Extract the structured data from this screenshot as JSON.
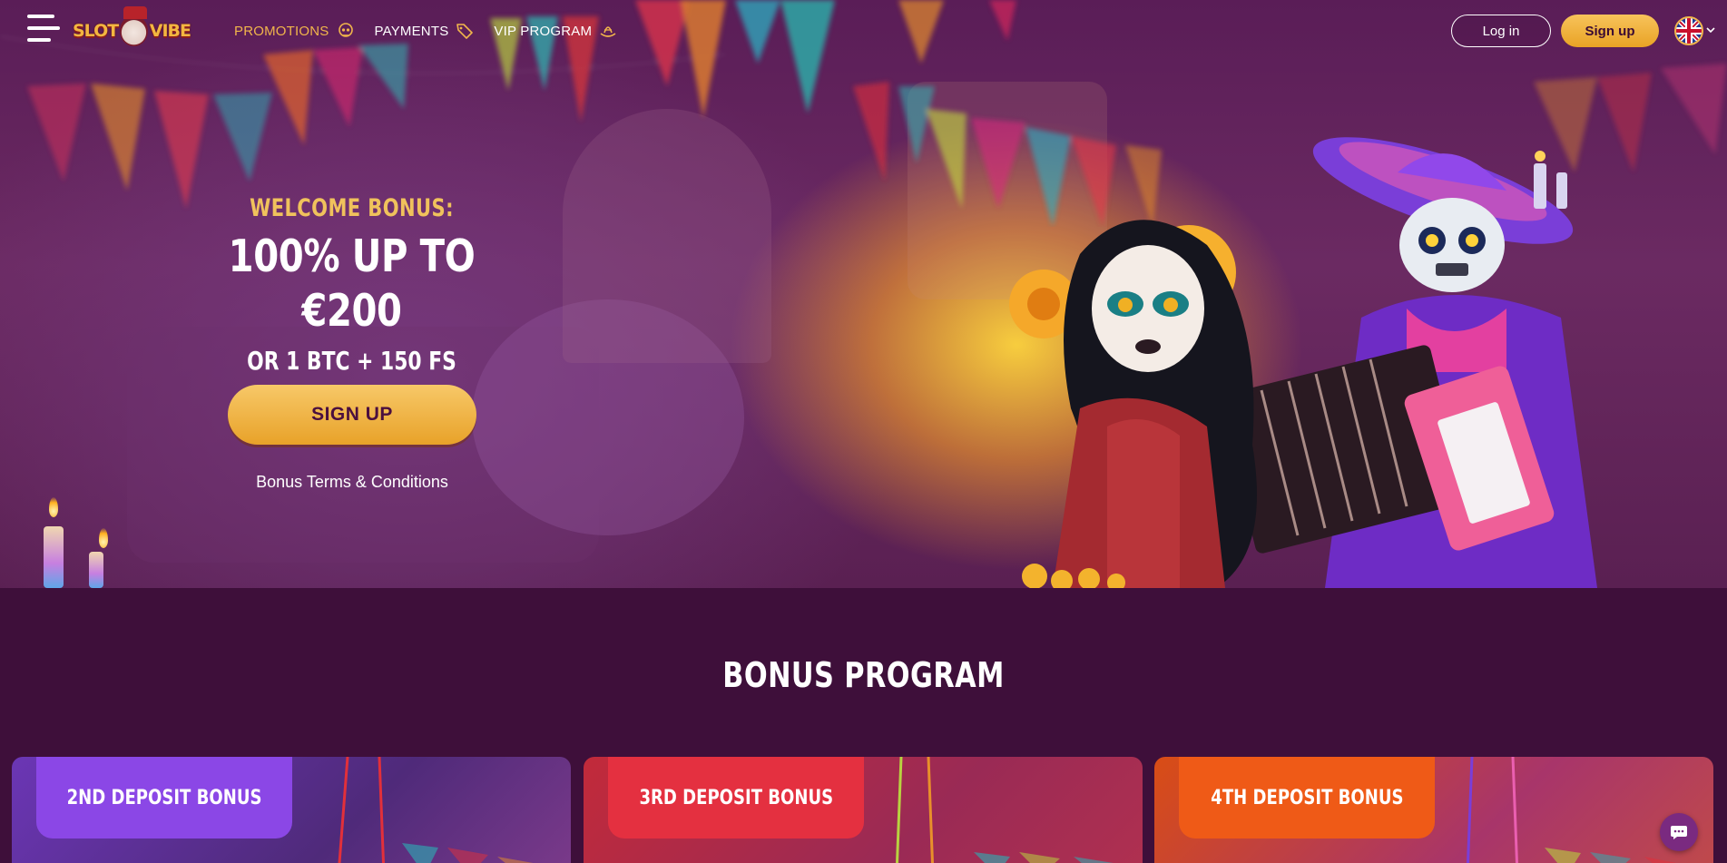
{
  "header": {
    "logo_alt": "Slot Vibe",
    "logo_text_left": "SLOT",
    "logo_text_right": "VIBE",
    "nav": [
      {
        "label": "PROMOTIONS",
        "icon": "sugar-skull-icon",
        "active": true
      },
      {
        "label": "PAYMENTS",
        "icon": "tag-icon",
        "active": false
      },
      {
        "label": "VIP PROGRAM",
        "icon": "sombrero-icon",
        "active": false
      }
    ],
    "login_label": "Log in",
    "signup_label": "Sign up",
    "language_icon": "uk-flag-icon"
  },
  "hero": {
    "lead": "WELCOME BONUS:",
    "headline": "100% UP TO €200",
    "subline": "OR 1 BTC + 150 FS",
    "cta_label": "SIGN UP",
    "terms_link": "Bonus Terms & Conditions"
  },
  "bonus_program": {
    "title": "BONUS PROGRAM",
    "cards": [
      {
        "title": "2ND DEPOSIT BONUS",
        "color": "#8b47e6",
        "bg": "#6a36b8"
      },
      {
        "title": "3RD DEPOSIT BONUS",
        "color": "#e43040",
        "bg": "#c22a3a"
      },
      {
        "title": "4TH DEPOSIT BONUS",
        "color": "#ef5a17",
        "bg": "#d94d15"
      }
    ]
  },
  "colors": {
    "accent_gold": "#f1b54b",
    "background": "#3e0f3a"
  },
  "chat_icon": "chat-bubble-icon"
}
